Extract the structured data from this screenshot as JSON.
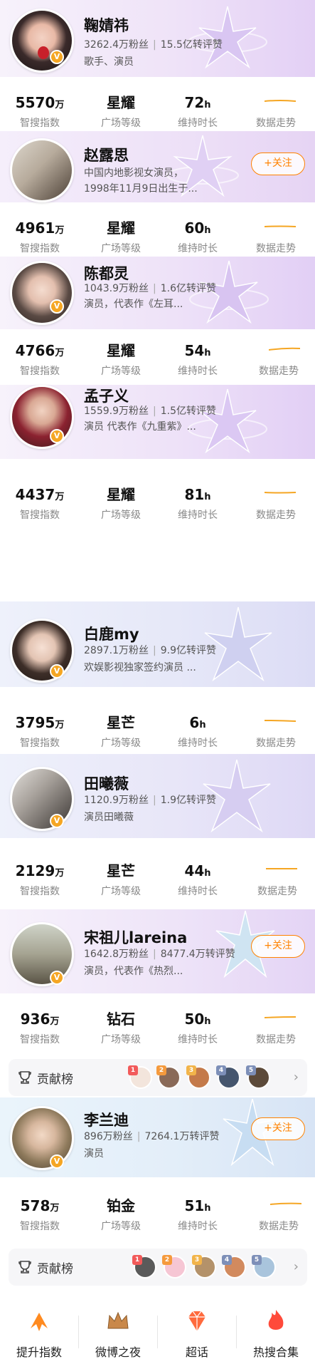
{
  "colors": {
    "accent": "#ff8200",
    "vbadge": "#f5a623",
    "trend": "#f5a623"
  },
  "stat_labels": {
    "index": "智搜指数",
    "level": "广场等级",
    "duration": "维持时长",
    "trend": "数据走势"
  },
  "units": {
    "wan": "万",
    "hour": "h"
  },
  "contrib_label": "贡献榜",
  "follow_label": "+关注",
  "entries": [
    {
      "name": "鞠婧祎",
      "fans": "3262.4万粉丝",
      "reposts": "15.5亿转评赞",
      "desc": "歌手、演员",
      "index": "5570",
      "level": "星耀",
      "duration": "72"
    },
    {
      "name": "赵露思",
      "desc": "中国内地影视女演员，",
      "desc2": "1998年11月9日出生于...",
      "index": "4961",
      "level": "星耀",
      "duration": "60"
    },
    {
      "name": "陈都灵",
      "fans": "1043.9万粉丝",
      "reposts": "1.6亿转评赞",
      "desc": "演员，代表作《左耳...",
      "index": "4766",
      "level": "星耀",
      "duration": "54"
    },
    {
      "name": "孟子义",
      "fans": "1559.9万粉丝",
      "reposts": "1.5亿转评赞",
      "desc": "演员 代表作《九重紫》...",
      "index": "4437",
      "level": "星耀",
      "duration": "81"
    },
    {
      "name": "白鹿my",
      "fans": "2897.1万粉丝",
      "reposts": "9.9亿转评赞",
      "desc": "欢娱影视独家签约演员 ...",
      "index": "3795",
      "level": "星芒",
      "duration": "6"
    },
    {
      "name": "田曦薇",
      "fans": "1120.9万粉丝",
      "reposts": "1.9亿转评赞",
      "desc": "演员田曦薇",
      "index": "2129",
      "level": "星芒",
      "duration": "44"
    },
    {
      "name": "宋祖儿lareina",
      "fans": "1642.8万粉丝",
      "reposts": "8477.4万转评赞",
      "desc": "演员，代表作《热烈...",
      "index": "936",
      "level": "钻石",
      "duration": "50"
    },
    {
      "name": "李兰迪",
      "fans": "896万粉丝",
      "reposts": "7264.1万转评赞",
      "desc": "演员",
      "index": "578",
      "level": "铂金",
      "duration": "51"
    }
  ],
  "bottom_nav": [
    {
      "label": "提升指数",
      "icon": "arrow-up-icon"
    },
    {
      "label": "微博之夜",
      "icon": "crown-icon"
    },
    {
      "label": "超话",
      "icon": "diamond-icon"
    },
    {
      "label": "热搜合集",
      "icon": "flame-icon"
    }
  ],
  "rank_numbers": [
    "1",
    "2",
    "3",
    "4",
    "5"
  ]
}
